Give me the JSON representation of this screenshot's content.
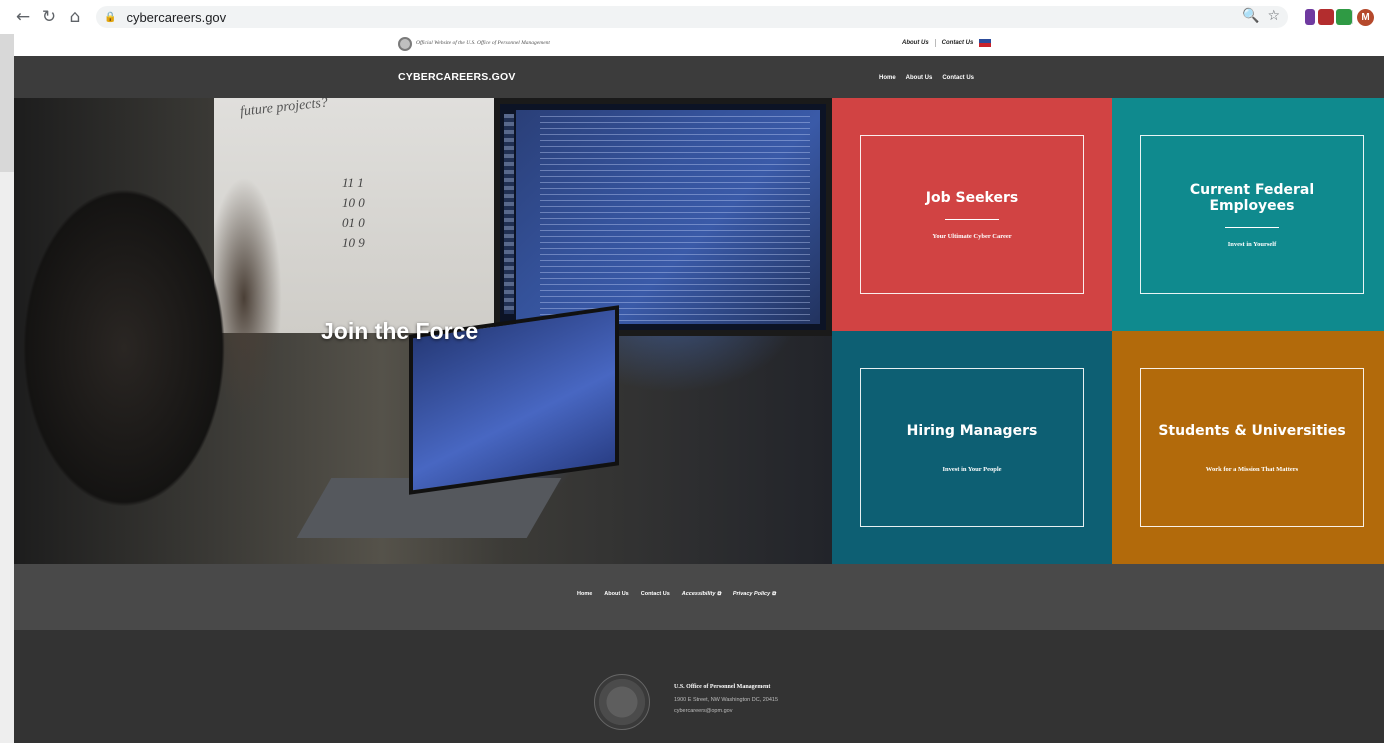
{
  "browser": {
    "url": "cybercareers.gov",
    "back": "←",
    "reload": "↻",
    "home": "⌂",
    "profile_initial": "M"
  },
  "topbar": {
    "official_text": "Official Website of the U.S. Office of Personnel Management",
    "about": "About Us",
    "contact": "Contact Us"
  },
  "header": {
    "logo": "CYBERCAREERS.GOV",
    "nav": [
      "Home",
      "About Us",
      "Contact Us"
    ]
  },
  "hero": {
    "title": "Join the Force",
    "whiteboard_text": "future projects?",
    "whiteboard_nums": [
      "11  1",
      "10  0",
      "01  0",
      "10  9"
    ]
  },
  "tiles": [
    {
      "title": "Job Seekers",
      "subtitle": "Your Ultimate Cyber Career",
      "color": "#d14343"
    },
    {
      "title": "Current Federal Employees",
      "subtitle": "Invest in Yourself",
      "color": "#0f8a8e"
    },
    {
      "title": "Hiring Managers",
      "subtitle": "Invest in Your People",
      "color": "#0d5f73"
    },
    {
      "title": "Students & Universities",
      "subtitle": "Work for a Mission That Matters",
      "color": "#b26a0b"
    }
  ],
  "footer": {
    "nav": [
      "Home",
      "About Us",
      "Contact Us",
      "Accessibility",
      "Privacy Policy"
    ],
    "org_name": "U.S. Office of Personnel Management",
    "address": "1900 E Street, NW Washington DC, 20415",
    "email": "cybercareers@opm.gov"
  },
  "colors": {
    "header_bg": "#3c3c3c",
    "footer_nav_bg": "#494949",
    "footer_bg": "#333333"
  }
}
